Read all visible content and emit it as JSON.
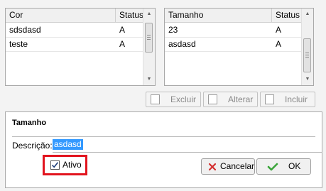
{
  "cor_grid": {
    "col_cor": "Cor",
    "col_status": "Status",
    "rows": [
      {
        "cor": "sdsdasd",
        "status": "A"
      },
      {
        "cor": "teste",
        "status": "A"
      }
    ]
  },
  "tamanho_grid": {
    "col_tamanho": "Tamanho",
    "col_status": "Status",
    "rows": [
      {
        "tamanho": "23",
        "status": "A"
      },
      {
        "tamanho": "asdasd",
        "status": "A"
      }
    ]
  },
  "toolbar": {
    "excluir": "Excluir",
    "alterar": "Alterar",
    "incluir": "Incluir"
  },
  "form": {
    "title": "Tamanho",
    "descricao_label": "Descrição:",
    "descricao_value": "asdasd",
    "ativo_label": "Ativo",
    "ativo_checked": true,
    "cancelar": "Cancelar",
    "ok": "OK"
  },
  "colors": {
    "highlight_border": "#e2141e",
    "selection": "#3399ff",
    "cancel_icon": "#d32f2f",
    "ok_icon": "#3aa53a"
  }
}
